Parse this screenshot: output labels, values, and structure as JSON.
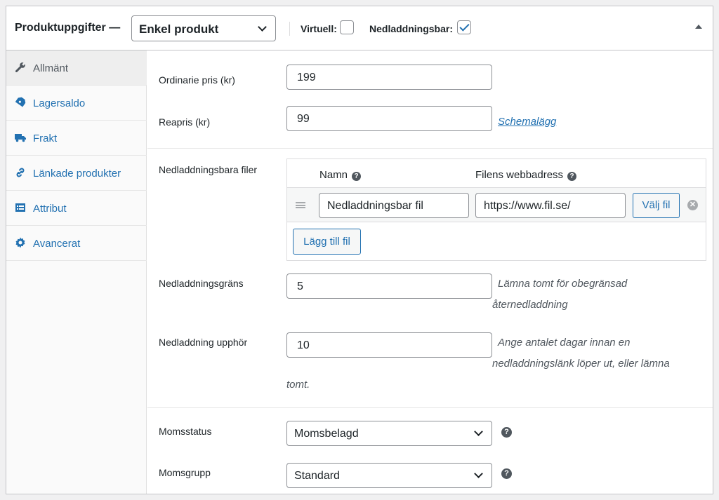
{
  "header": {
    "title": "Produktuppgifter —",
    "product_type": "Enkel produkt",
    "virtual_label": "Virtuell:",
    "virtual_checked": false,
    "downloadable_label": "Nedladdningsbar:",
    "downloadable_checked": true
  },
  "sidebar": {
    "items": [
      {
        "label": "Allmänt",
        "icon": "wrench-icon",
        "active": true
      },
      {
        "label": "Lagersaldo",
        "icon": "tag-icon",
        "active": false
      },
      {
        "label": "Frakt",
        "icon": "truck-icon",
        "active": false
      },
      {
        "label": "Länkade produkter",
        "icon": "link-icon",
        "active": false
      },
      {
        "label": "Attribut",
        "icon": "list-icon",
        "active": false
      },
      {
        "label": "Avancerat",
        "icon": "gear-icon",
        "active": false
      }
    ]
  },
  "pricing": {
    "regular_label": "Ordinarie pris (kr)",
    "regular_value": "199",
    "sale_label": "Reapris (kr)",
    "sale_value": "99",
    "schedule_link": "Schemalägg"
  },
  "downloads": {
    "label": "Nedladdningsbara filer",
    "col_name": "Namn",
    "col_url": "Filens webbadress",
    "files": [
      {
        "name": "Nedladdningsbar fil",
        "url": "https://www.fil.se/"
      }
    ],
    "choose_button": "Välj fil",
    "add_button": "Lägg till fil",
    "limit_label": "Nedladdningsgräns",
    "limit_value": "5",
    "limit_desc_1": "Lämna tomt för obegränsad",
    "limit_desc_2": "åternedladdning",
    "expiry_label": "Nedladdning upphör",
    "expiry_value": "10",
    "expiry_desc_1": "Ange antalet dagar innan en",
    "expiry_desc_2": "nedladdningslänk löper ut, eller lämna",
    "expiry_desc_3": "tomt."
  },
  "tax": {
    "status_label": "Momsstatus",
    "status_value": "Momsbelagd",
    "class_label": "Momsgrupp",
    "class_value": "Standard"
  },
  "colors": {
    "accent": "#2271b1",
    "border": "#8c8f94",
    "sidebar_bg": "#fafafa"
  }
}
